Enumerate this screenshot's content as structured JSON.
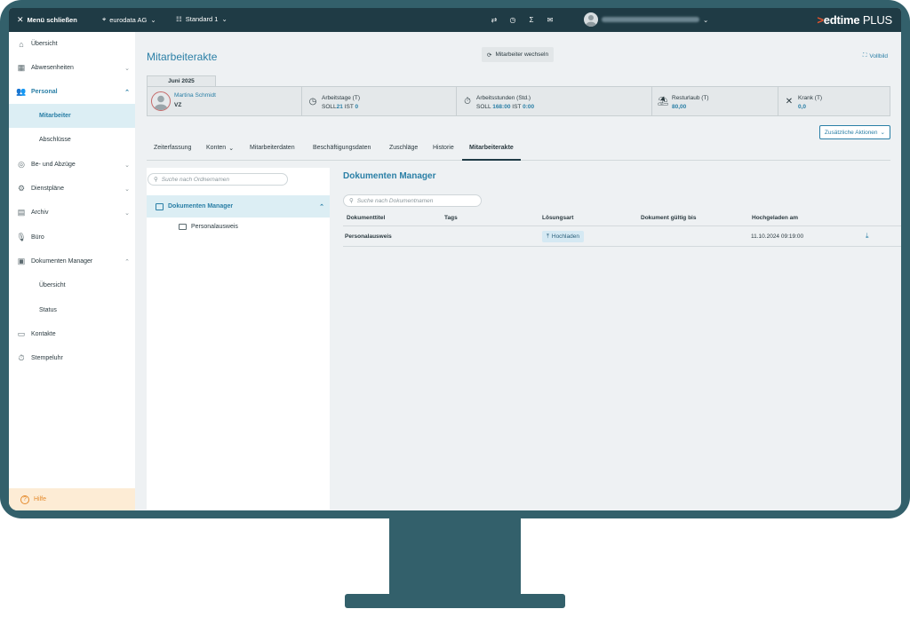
{
  "topbar": {
    "close_menu": "Menü schließen",
    "company": "eurodata AG",
    "standard": "Standard 1",
    "icons": [
      "filter-icon",
      "clock-icon",
      "sigma-icon",
      "mail-icon"
    ],
    "brand_prefix": ">",
    "brand_bold": "edtime",
    "brand_rest": " PLUS"
  },
  "sidebar": {
    "items": [
      {
        "label": "Übersicht",
        "icon": "home-icon"
      },
      {
        "label": "Abwesenheiten",
        "icon": "calendar-icon"
      },
      {
        "label": "Personal",
        "icon": "people-icon"
      },
      {
        "label": "Mitarbeiter"
      },
      {
        "label": "Abschlüsse"
      },
      {
        "label": "Be- und Abzüge",
        "icon": "coins-icon"
      },
      {
        "label": "Dienstpläne",
        "icon": "schedule-icon"
      },
      {
        "label": "Archiv",
        "icon": "archive-icon"
      },
      {
        "label": "Büro",
        "icon": "microphone-icon"
      },
      {
        "label": "Dokumenten Manager",
        "icon": "document-icon"
      },
      {
        "label": "Übersicht"
      },
      {
        "label": "Status"
      },
      {
        "label": "Kontakte",
        "icon": "contacts-icon"
      },
      {
        "label": "Stempeluhr",
        "icon": "stopwatch-icon"
      }
    ],
    "help": "Hilfe"
  },
  "main": {
    "title": "Mitarbeiterakte",
    "switch_label": "Mitarbeiter wechseln",
    "fullscreen_label": "Vollbild",
    "month": "Juni 2025",
    "employee": {
      "name": "Martina Schmidt",
      "code": "VZ"
    },
    "stats": [
      {
        "label": "Arbeitstage (T)",
        "soll_label": "SOLL",
        "soll": "21",
        "ist_label": "IST",
        "ist": "0"
      },
      {
        "label": "Arbeitsstunden (Std.)",
        "soll_label": "SOLL",
        "soll": "168:00",
        "ist_label": "IST",
        "ist": "0:00"
      },
      {
        "label": "Resturlaub (T)",
        "value": "80,00"
      },
      {
        "label": "Krank (T)",
        "value": "0,0"
      }
    ],
    "actions_label": "Zusätzliche Aktionen",
    "tabs": [
      "Zeiterfassung",
      "Konten",
      "Mitarbeiterdaten",
      "Beschäftigungsdaten",
      "Zuschläge",
      "Historie",
      "Mitarbeiterakte"
    ]
  },
  "folders": {
    "search_placeholder": "Suche nach Ordnernamen",
    "root": "Dokumenten Manager",
    "child": "Personalausweis"
  },
  "documents": {
    "title": "Dokumenten Manager",
    "search_placeholder": "Suche nach Dokumentnamen",
    "columns": [
      "Dokumenttitel",
      "Tags",
      "Lösungsart",
      "Dokument gültig bis",
      "Hochgeladen am"
    ],
    "rows": [
      {
        "title": "Personalausweis",
        "tags": "",
        "type": "Hochladen",
        "valid_until": "",
        "uploaded": "11.10.2024 09:19:00"
      }
    ]
  }
}
